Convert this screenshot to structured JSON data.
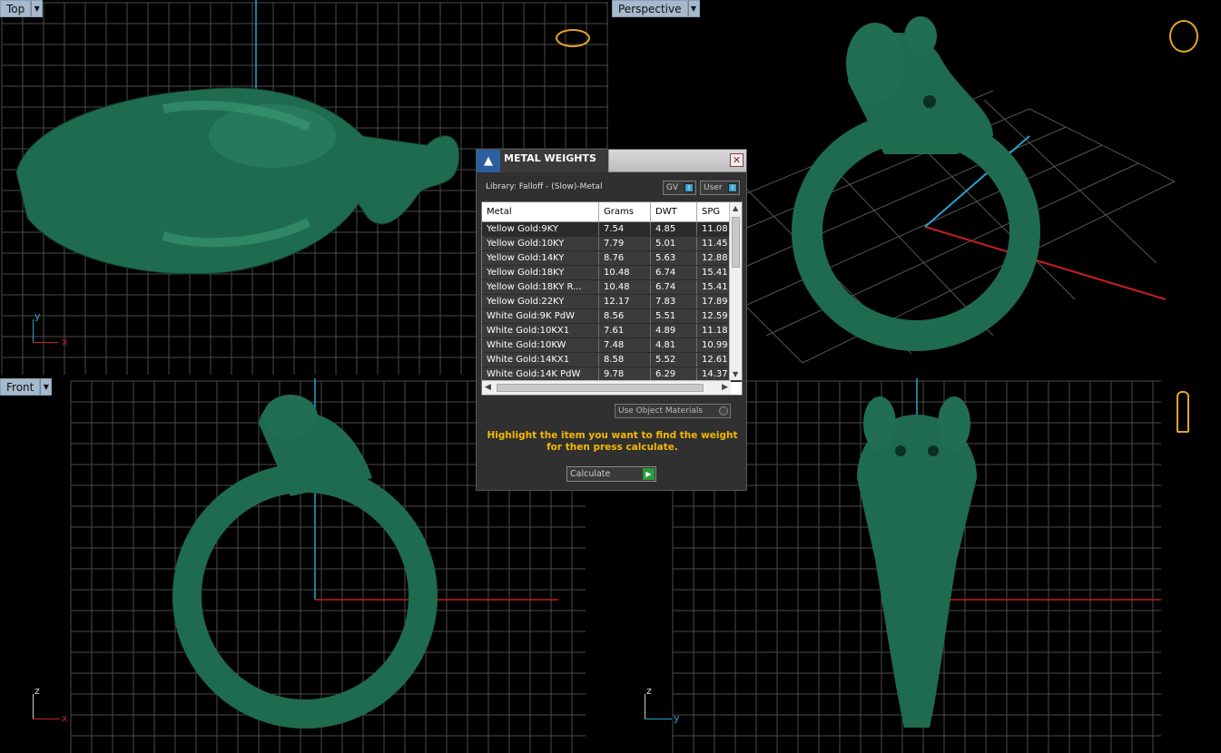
{
  "viewports": {
    "top": {
      "label": "Top",
      "axis_v": "y",
      "axis_h": "x"
    },
    "perspective": {
      "label": "Perspective"
    },
    "front": {
      "label": "Front",
      "axis_v": "z",
      "axis_h": "x"
    },
    "right": {
      "axis_v": "z",
      "axis_h": "y"
    }
  },
  "colors": {
    "model": "#1f6b4f",
    "grid": "#4a4a4a",
    "axis_x": "#c81e1e",
    "axis_y": "#2aa3c8",
    "hint": "#f5b800"
  },
  "panel": {
    "title": "METAL WEIGHTS",
    "library": "Library: Falloff - (Slow)-Metal",
    "toggle_gv": "GV",
    "toggle_user": "User",
    "columns": [
      "Metal",
      "Grams",
      "DWT",
      "SPG"
    ],
    "rows": [
      [
        "Yellow Gold:9KY",
        "7.54",
        "4.85",
        "11.08"
      ],
      [
        "Yellow Gold:10KY",
        "7.79",
        "5.01",
        "11.45"
      ],
      [
        "Yellow Gold:14KY",
        "8.76",
        "5.63",
        "12.88"
      ],
      [
        "Yellow Gold:18KY",
        "10.48",
        "6.74",
        "15.41"
      ],
      [
        "Yellow Gold:18KY R...",
        "10.48",
        "6.74",
        "15.41"
      ],
      [
        "Yellow Gold:22KY",
        "12.17",
        "7.83",
        "17.89"
      ],
      [
        "White Gold:9K PdW",
        "8.56",
        "5.51",
        "12.59"
      ],
      [
        "White Gold:10KX1",
        "7.61",
        "4.89",
        "11.18"
      ],
      [
        "White Gold:10KW",
        "7.48",
        "4.81",
        "10.99"
      ],
      [
        "White Gold:14KX1",
        "8.58",
        "5.52",
        "12.61"
      ],
      [
        "White Gold:14K PdW",
        "9.78",
        "6.29",
        "14.37"
      ]
    ],
    "use_object_materials": "Use Object Materials",
    "hint": "Highlight the item you want to find the weight for then press calculate.",
    "calculate": "Calculate"
  }
}
